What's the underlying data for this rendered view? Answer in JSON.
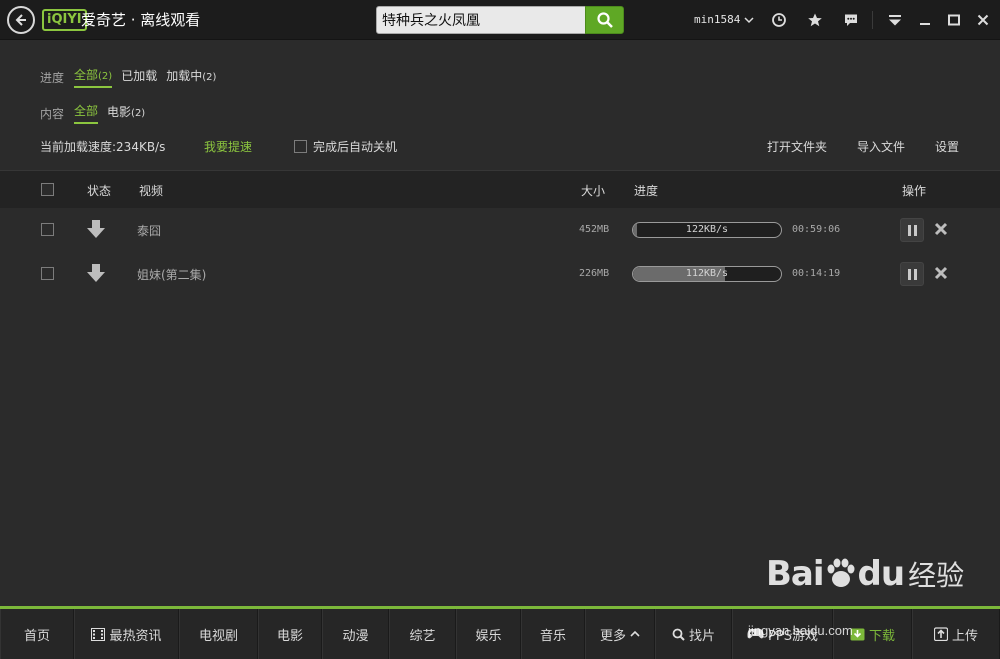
{
  "titlebar": {
    "app_logo": "iQIYI",
    "title": "爱奇艺 · 离线观看",
    "search_value": "特种兵之火凤凰",
    "username": "min1584",
    "icons": [
      "back-icon",
      "search-icon",
      "chevron-down-icon",
      "history-icon",
      "star-icon",
      "message-icon",
      "menu-icon",
      "minimize-icon",
      "maximize-icon",
      "close-icon"
    ]
  },
  "filters": {
    "progress_label": "进度",
    "progress_options": [
      {
        "label": "全部",
        "count": "(2)",
        "active": true
      },
      {
        "label": "已加载",
        "count": "",
        "active": false
      },
      {
        "label": "加载中",
        "count": "(2)",
        "active": false
      }
    ],
    "content_label": "内容",
    "content_options": [
      {
        "label": "全部",
        "count": "",
        "active": true
      },
      {
        "label": "电影",
        "count": "(2)",
        "active": false
      }
    ]
  },
  "toolbar": {
    "speed_text": "当前加载速度:234KB/s",
    "boost_link": "我要提速",
    "auto_shutdown": "完成后自动关机",
    "open_folder": "打开文件夹",
    "import_file": "导入文件",
    "settings": "设置"
  },
  "table": {
    "headers": {
      "status": "状态",
      "video": "视频",
      "size": "大小",
      "progress": "进度",
      "actions": "操作"
    },
    "rows": [
      {
        "name": "泰囧",
        "size": "452MB",
        "speed": "122KB/s",
        "progress": 0.02,
        "time": "00:59:06"
      },
      {
        "name": "姐妹(第二集)",
        "size": "226MB",
        "speed": "112KB/s",
        "progress": 0.62,
        "time": "00:14:19"
      }
    ]
  },
  "bottom_nav": [
    {
      "label": "首页",
      "icon": ""
    },
    {
      "label": "最热资讯",
      "icon": "film-icon"
    },
    {
      "label": "电视剧",
      "icon": ""
    },
    {
      "label": "电影",
      "icon": ""
    },
    {
      "label": "动漫",
      "icon": ""
    },
    {
      "label": "综艺",
      "icon": ""
    },
    {
      "label": "娱乐",
      "icon": ""
    },
    {
      "label": "音乐",
      "icon": ""
    },
    {
      "label": "更多",
      "icon": "chevron-up-icon"
    },
    {
      "label": "找片",
      "icon": "search-icon"
    },
    {
      "label": "PPS游戏",
      "icon": "gamepad-icon"
    },
    {
      "label": "下载",
      "icon": "download-icon",
      "active": true
    },
    {
      "label": "上传",
      "icon": "upload-icon"
    }
  ],
  "watermark": {
    "brand": "Bai",
    "brand2": "du",
    "cn": "经验",
    "url": "jingyan.baidu.com"
  },
  "colors": {
    "accent": "#8cc63f",
    "background": "#2b2b2b",
    "titlebar": "#1c1c1c",
    "search_button": "#5fa825"
  }
}
